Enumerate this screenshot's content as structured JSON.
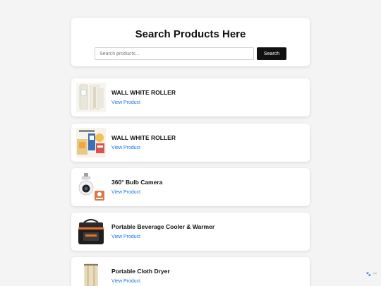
{
  "search": {
    "title": "Search Products Here",
    "placeholder": "Search products...",
    "value": "",
    "button_label": "Search"
  },
  "products": [
    {
      "name": "WALL WHITE ROLLER",
      "link_label": "View Product",
      "icon": "wall-roller-icon"
    },
    {
      "name": "WALL WHITE ROLLER",
      "link_label": "View Product",
      "icon": "wall-roller-icon"
    },
    {
      "name": "360° Bulb Camera",
      "link_label": "View Product",
      "icon": "bulb-camera-icon"
    },
    {
      "name": "Portable Beverage Cooler & Warmer",
      "link_label": "View Product",
      "icon": "cooler-icon"
    },
    {
      "name": "Portable Cloth Dryer",
      "link_label": "View Product",
      "icon": "cloth-dryer-icon"
    }
  ],
  "footer": {
    "logo_text": "🐾 ™"
  },
  "colors": {
    "accent": "#1a73e8",
    "button_bg": "#111111",
    "page_bg": "#f4f4f5"
  }
}
